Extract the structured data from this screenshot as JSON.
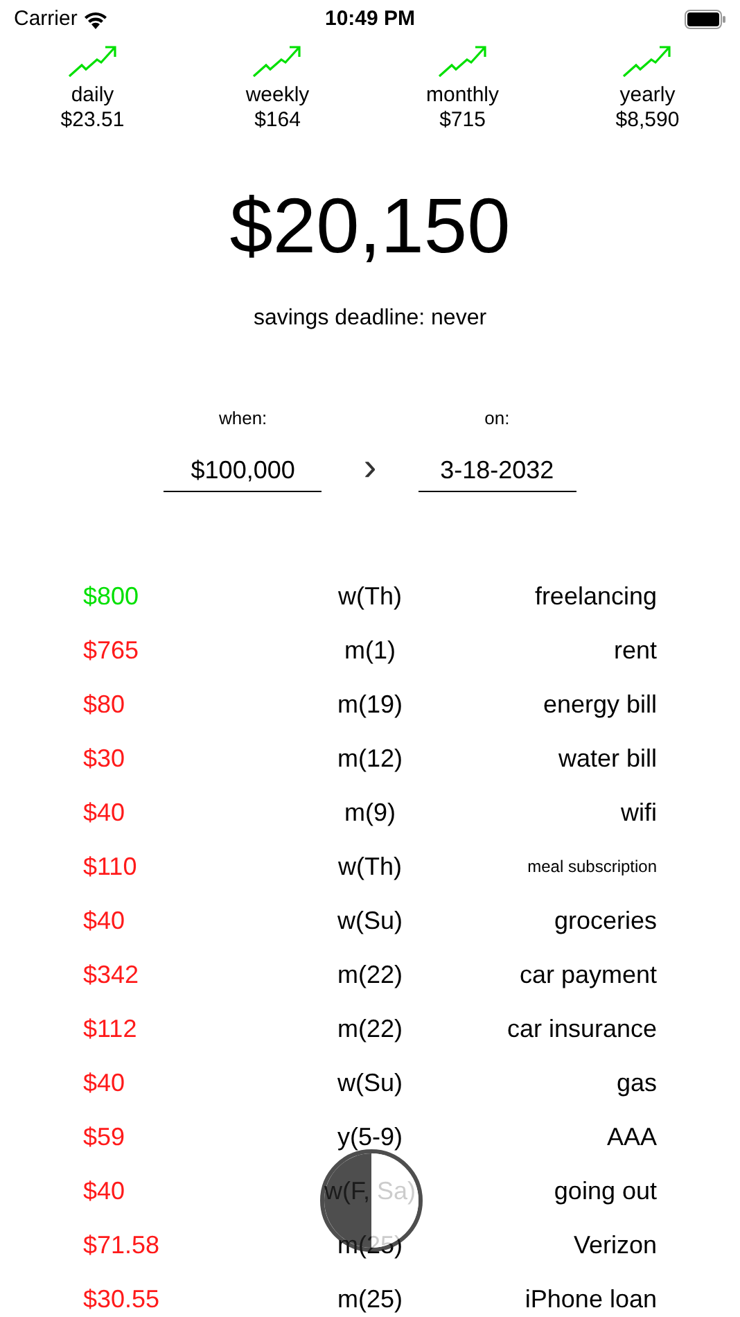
{
  "status_bar": {
    "carrier": "Carrier",
    "time": "10:49 PM"
  },
  "rates": [
    {
      "label": "daily",
      "value": "$23.51"
    },
    {
      "label": "weekly",
      "value": "$164"
    },
    {
      "label": "monthly",
      "value": "$715"
    },
    {
      "label": "yearly",
      "value": "$8,590"
    }
  ],
  "balance": "$20,150",
  "deadline": "savings deadline: never",
  "goal": {
    "when_label": "when:",
    "when_value": "$100,000",
    "chevron": "›",
    "on_label": "on:",
    "on_value": "3-18-2032"
  },
  "entries": [
    {
      "kind": "income",
      "amount": "$800",
      "schedule": "w(Th)",
      "name": "freelancing",
      "compact": false
    },
    {
      "kind": "expense",
      "amount": "$765",
      "schedule": "m(1)",
      "name": "rent",
      "compact": false
    },
    {
      "kind": "expense",
      "amount": "$80",
      "schedule": "m(19)",
      "name": "energy bill",
      "compact": false
    },
    {
      "kind": "expense",
      "amount": "$30",
      "schedule": "m(12)",
      "name": "water bill",
      "compact": false
    },
    {
      "kind": "expense",
      "amount": "$40",
      "schedule": "m(9)",
      "name": "wifi",
      "compact": false
    },
    {
      "kind": "expense",
      "amount": "$110",
      "schedule": "w(Th)",
      "name": "meal subscription",
      "compact": true
    },
    {
      "kind": "expense",
      "amount": "$40",
      "schedule": "w(Su)",
      "name": "groceries",
      "compact": false
    },
    {
      "kind": "expense",
      "amount": "$342",
      "schedule": "m(22)",
      "name": "car payment",
      "compact": false
    },
    {
      "kind": "expense",
      "amount": "$112",
      "schedule": "m(22)",
      "name": "car insurance",
      "compact": false
    },
    {
      "kind": "expense",
      "amount": "$40",
      "schedule": "w(Su)",
      "name": "gas",
      "compact": false
    },
    {
      "kind": "expense",
      "amount": "$59",
      "schedule": "y(5-9)",
      "name": "AAA",
      "compact": false
    },
    {
      "kind": "expense",
      "amount": "$40",
      "schedule": "w(F, Sa)",
      "name": "going out",
      "compact": false
    },
    {
      "kind": "expense",
      "amount": "$71.58",
      "schedule": "m(25)",
      "name": "Verizon",
      "compact": false
    },
    {
      "kind": "expense",
      "amount": "$30.55",
      "schedule": "m(25)",
      "name": "iPhone loan",
      "compact": false
    }
  ]
}
